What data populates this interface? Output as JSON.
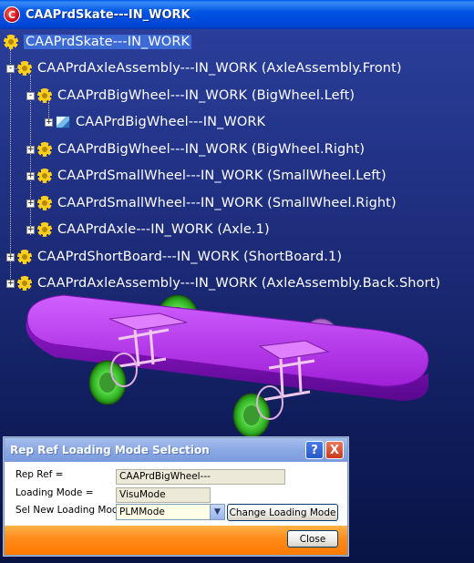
{
  "window": {
    "title": "CAAPrdSkate---IN_WORK",
    "icon": "catia-logo-icon"
  },
  "tree": {
    "nodes": [
      {
        "label": "CAAPrdSkate---IN_WORK",
        "icon": "product-gear-icon",
        "selected": true
      },
      {
        "label": "CAAPrdAxleAssembly---IN_WORK (AxleAssembly.Front)",
        "icon": "product-gear-icon",
        "expander": "-"
      },
      {
        "label": "CAAPrdBigWheel---IN_WORK (BigWheel.Left)",
        "icon": "product-gear-icon",
        "expander": "-"
      },
      {
        "label": "CAAPrdBigWheel---IN_WORK",
        "icon": "part-icon",
        "expander": "+"
      },
      {
        "label": "CAAPrdBigWheel---IN_WORK (BigWheel.Right)",
        "icon": "product-gear-icon",
        "expander": "+"
      },
      {
        "label": "CAAPrdSmallWheel---IN_WORK (SmallWheel.Left)",
        "icon": "product-gear-icon",
        "expander": "+"
      },
      {
        "label": "CAAPrdSmallWheel---IN_WORK (SmallWheel.Right)",
        "icon": "product-gear-icon",
        "expander": "+"
      },
      {
        "label": "CAAPrdAxle---IN_WORK (Axle.1)",
        "icon": "product-gear-icon",
        "expander": "+"
      },
      {
        "label": "CAAPrdShortBoard---IN_WORK (ShortBoard.1)",
        "icon": "product-gear-icon",
        "expander": "+"
      },
      {
        "label": "CAAPrdAxleAssembly---IN_WORK (AxleAssembly.Back.Short)",
        "icon": "product-gear-icon",
        "expander": "+"
      }
    ]
  },
  "dialog": {
    "title": "Rep Ref Loading Mode Selection",
    "help_label": "?",
    "close_x_label": "X",
    "rep_ref_label": "Rep Ref =",
    "rep_ref_value": "CAAPrdBigWheel---",
    "loading_mode_label": "Loading Mode =",
    "loading_mode_value": "VisuMode",
    "sel_new_label": "Sel New Loading Mode",
    "sel_new_value": "PLMMode",
    "change_button": "Change Loading Mode",
    "close_button": "Close"
  },
  "colors": {
    "board": "#b030e0",
    "wheel": "#30c020",
    "titlebar": "#0055e5",
    "dialog_accent": "#ff8a1a"
  }
}
